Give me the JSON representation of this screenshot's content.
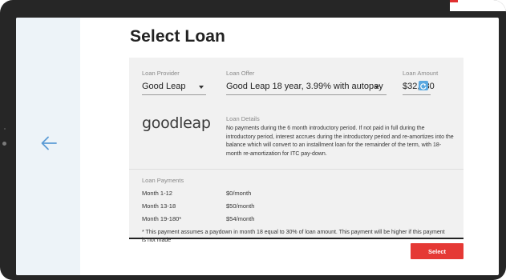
{
  "page": {
    "title": "Select Loan",
    "select_label": "Select"
  },
  "loan": {
    "provider_label": "Loan Provider",
    "provider_value": "Good Leap",
    "offer_label": "Loan Offer",
    "offer_value": "Good Leap 18 year, 3.99% with autopay",
    "amount_label": "Loan Amount",
    "amount_value": "$32,830",
    "logo_text": "goodleap",
    "details_label": "Loan Details",
    "details_text": "No payments during the 6 month introductory period. If not paid in full during the introductory period, interest accrues during the introductory period and re-amortizes into the balance which will convert to an installment loan for the remainder of the term, with 18-month re-amortization for ITC pay-down."
  },
  "payments": {
    "label": "Loan Payments",
    "rows": [
      {
        "period": "Month 1-12",
        "amount": "$0/month"
      },
      {
        "period": "Month 13-18",
        "amount": "$50/month"
      },
      {
        "period": "Month 19-180*",
        "amount": "$54/month"
      }
    ],
    "note": "* This payment assumes a paydown in month 18 equal to 30% of loan amount. This payment will be higher if this payment is not made"
  },
  "colors": {
    "accent": "#e53935",
    "refresh": "#5aa8e0",
    "sidebar": "#edf3f8",
    "back_arrow": "#5b9bd5"
  },
  "icons": {
    "back": "arrow-left-icon",
    "refresh": "refresh-icon",
    "dropdown": "chevron-down-icon"
  }
}
